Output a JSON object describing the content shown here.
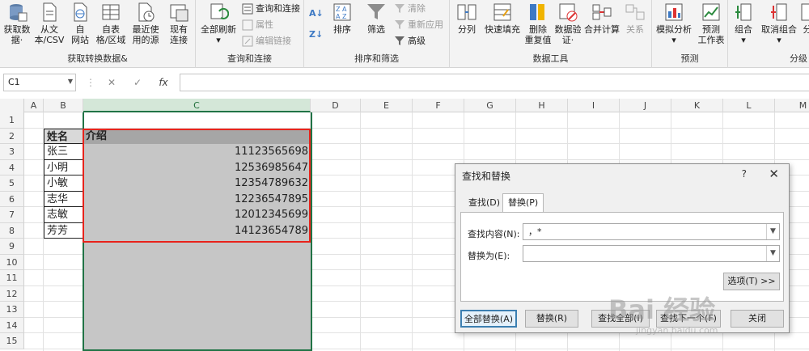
{
  "ribbon": {
    "groups": [
      {
        "label": "获取转换数据&"
      },
      {
        "label": "查询和连接"
      },
      {
        "label": "排序和筛选"
      },
      {
        "label": "数据工具"
      },
      {
        "label": "预测"
      },
      {
        "label": "分级"
      }
    ],
    "get_data": {
      "line1": "获取数",
      "line2": "据·"
    },
    "from_text": {
      "line1": "从文",
      "line2": "本/CSV"
    },
    "from_web": {
      "line1": "自",
      "line2": "网站"
    },
    "from_table": {
      "line1": "自表",
      "line2": "格/区域"
    },
    "recent_sources": {
      "line1": "最近使",
      "line2": "用的源"
    },
    "existing": {
      "line1": "现有",
      "line2": "连接"
    },
    "refresh_all": {
      "line1": "全部刷新",
      "line2": "▾"
    },
    "queries_connections": "查询和连接",
    "properties": "属性",
    "edit_links": "编辑链接",
    "sort": "排序",
    "filter": "筛选",
    "clear": "清除",
    "reapply": "重新应用",
    "advanced": "高级",
    "text_to_columns": "分列",
    "flash_fill": "快速填充",
    "remove_dup": {
      "line1": "删除",
      "line2": "重复值"
    },
    "validation": {
      "line1": "数据验",
      "line2": "证·"
    },
    "consolidate": "合并计算",
    "relationships": "关系",
    "what_if": {
      "line1": "模拟分析",
      "line2": "▾"
    },
    "forecast": {
      "line1": "预测",
      "line2": "工作表"
    },
    "group": {
      "line1": "组合",
      "line2": "▾"
    },
    "ungroup": {
      "line1": "取消组合",
      "line2": "▾"
    },
    "subtotal": {
      "line1": "分",
      "line2": ""
    }
  },
  "formula_bar": {
    "name_box": "C1",
    "fx": "fx",
    "formula": ""
  },
  "sheet": {
    "columns": [
      "A",
      "B",
      "C",
      "D",
      "E",
      "F",
      "G",
      "H",
      "I",
      "J",
      "K",
      "L",
      "M"
    ],
    "rows": [
      "1",
      "2",
      "3",
      "4",
      "5",
      "6",
      "7",
      "8",
      "9",
      "10",
      "11",
      "12",
      "13",
      "14",
      "15"
    ],
    "header_name": "姓名",
    "header_intro": "介绍",
    "names": [
      "张三",
      "小明",
      "小敏",
      "志华",
      "志敏",
      "芳芳"
    ],
    "intros": [
      "11123565698",
      "12536985647",
      "12354789632",
      "12236547895",
      "12012345699",
      "14123654789"
    ]
  },
  "dialog": {
    "title": "查找和替换",
    "help": "?",
    "close": "✕",
    "tab_find": "查找(D)",
    "tab_replace": "替换(P)",
    "find_label": "查找内容(N):",
    "find_value": "，*",
    "replace_label": "替换为(E):",
    "replace_value": "",
    "options": "选项(T) >>",
    "replace_all": "全部替换(A)",
    "replace": "替换(R)",
    "find_all": "查找全部(I)",
    "find_next": "查找下一个(F)",
    "close_btn": "关闭"
  },
  "watermark": {
    "text": "Bai 经验",
    "sub": "jingyan.baidu.com"
  },
  "colors": {
    "excel_green": "#217346",
    "red_outline": "#e8231b",
    "selection_gray": "#c6c6c6"
  }
}
